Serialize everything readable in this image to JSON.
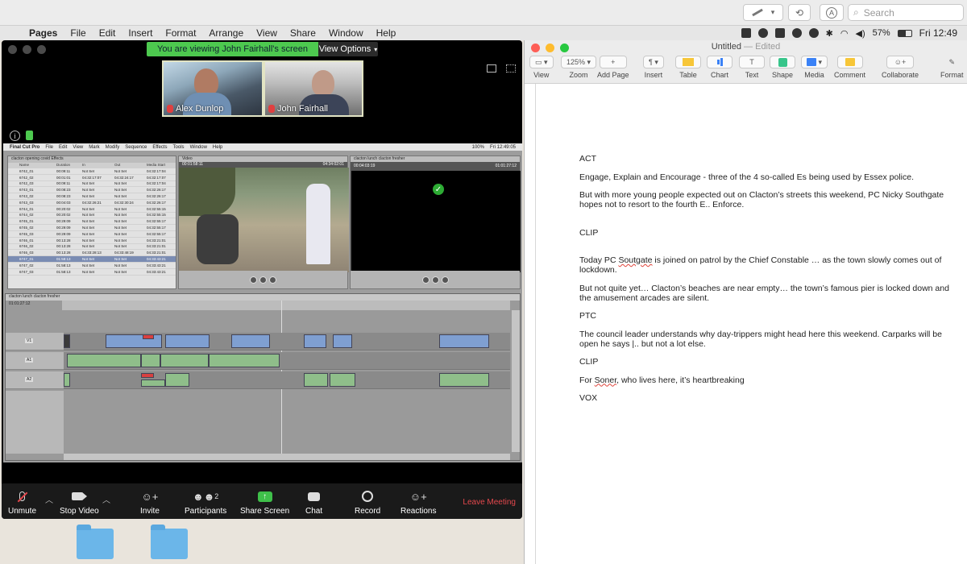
{
  "top_toolbar": {
    "search_placeholder": "Search"
  },
  "menubar": {
    "app": "Pages",
    "items": [
      "File",
      "Edit",
      "Insert",
      "Format",
      "Arrange",
      "View",
      "Share",
      "Window",
      "Help"
    ],
    "battery": "57%",
    "clock": "Fri 12:49"
  },
  "zoom": {
    "banner": "You are viewing John Fairhall's screen",
    "view_options": "View Options",
    "participants": [
      {
        "name": "Alex Dunlop"
      },
      {
        "name": "John Fairhall"
      }
    ],
    "controls": {
      "unmute": "Unmute",
      "stop_video": "Stop Video",
      "invite": "Invite",
      "participants": "Participants",
      "participants_count": "2",
      "share_screen": "Share Screen",
      "chat": "Chat",
      "record": "Record",
      "reactions": "Reactions",
      "leave": "Leave Meeting"
    }
  },
  "fcp": {
    "menu": [
      "Final Cut Pro",
      "File",
      "Edit",
      "View",
      "Mark",
      "Modify",
      "Sequence",
      "Effects",
      "Tools",
      "Window",
      "Help"
    ],
    "clock": "Fri 12:49:05",
    "battery": "100%",
    "browser_tabs": "clacton opening covid   Effects",
    "columns": [
      "Name",
      "Duration",
      "In",
      "Out",
      "Media Start"
    ],
    "rows": [
      [
        "6742_01",
        "00:09:11",
        "Not Set",
        "Not Set",
        "04:32:17:04"
      ],
      [
        "6742_02",
        "00:01:01",
        "04:32:17:07",
        "04:32:24:17",
        "04:32:17:07"
      ],
      [
        "6742_03",
        "00:09:11",
        "Not Set",
        "Not Set",
        "04:32:17:04"
      ],
      [
        "6743_01",
        "00:08:23",
        "Not Set",
        "Not Set",
        "04:32:26:17"
      ],
      [
        "6743_02",
        "00:08:23",
        "Not Set",
        "Not Set",
        "04:32:26:17"
      ],
      [
        "6743_03",
        "00:04:03",
        "04:32:26:21",
        "04:32:30:24",
        "04:32:26:17"
      ],
      [
        "6744_01",
        "00:20:02",
        "Not Set",
        "Not Set",
        "04:32:55:15"
      ],
      [
        "6744_02",
        "00:20:02",
        "Not Set",
        "Not Set",
        "04:32:55:15"
      ],
      [
        "6745_01",
        "00:29:09",
        "Not Set",
        "Not Set",
        "04:32:55:17"
      ],
      [
        "6745_02",
        "00:29:09",
        "Not Set",
        "Not Set",
        "04:32:55:17"
      ],
      [
        "6745_03",
        "00:29:09",
        "Not Set",
        "Not Set",
        "04:32:55:17"
      ],
      [
        "6746_01",
        "00:13:28",
        "Not Set",
        "Not Set",
        "04:33:21:01"
      ],
      [
        "6746_02",
        "00:13:28",
        "Not Set",
        "Not Set",
        "04:33:21:01"
      ],
      [
        "6746_03",
        "00:13:28",
        "04:33:28:13",
        "04:33:48:19",
        "04:33:21:01"
      ],
      [
        "6747_01",
        "01:58:13",
        "Not Set",
        "Not Set",
        "04:33:43:21"
      ],
      [
        "6747_02",
        "01:58:13",
        "Not Set",
        "Not Set",
        "04:33:43:21"
      ],
      [
        "6747_03",
        "01:58:13",
        "Not Set",
        "Not Set",
        "04:33:43:21"
      ]
    ],
    "viewer_timecode": "00:01:58:11",
    "viewer_duration": "04:34:02:01",
    "canvas_timecode": "00:04:03:19",
    "canvas_duration": "01:01:27:12",
    "timeline_tabs": "clacton lunch   clacton fresher",
    "timeline_timecode": "01:01:27:12",
    "tracks": [
      "V1",
      "A1",
      "A2"
    ]
  },
  "pages": {
    "title": "Untitled",
    "title_suffix": "— Edited",
    "toolbar": [
      "View",
      "Zoom",
      "Add Page",
      "Insert",
      "Table",
      "Chart",
      "Text",
      "Shape",
      "Media",
      "Comment",
      "Collaborate",
      "Format"
    ],
    "zoom_value": "125%",
    "doc": {
      "p1": "ACT",
      "p2": "Engage, Explain and Encourage - three of the 4 so-called Es being used by Essex police.",
      "p3": "But with more young people expected out on Clacton’s streets this weekend, PC Nicky Southgate hopes not to resort to the fourth E.. Enforce.",
      "p4": "CLIP",
      "p5a": "Today PC ",
      "p5b": "Soutgate",
      "p5c": " is joined on patrol by the Chief Constable … as the town slowly comes out of lockdown.",
      "p6": "But not quite yet… Clacton’s beaches are near empty… the town’s famous pier is locked down and the amusement arcades are silent.",
      "p7": "PTC",
      "p8": "The council leader understands why day-trippers might head here this weekend. Carparks will be open he says |.. but not a lot else.",
      "p9": "CLIP",
      "p10a": "For ",
      "p10b": "Soner",
      "p10c": ", who lives here, it’s heartbreaking",
      "p11": "VOX"
    }
  },
  "colors": {
    "zoom_green": "#4dc94f",
    "leave_red": "#e5484d",
    "fcp_video_clip": "#7f9fd1",
    "fcp_audio_clip": "#8fbe8a"
  }
}
